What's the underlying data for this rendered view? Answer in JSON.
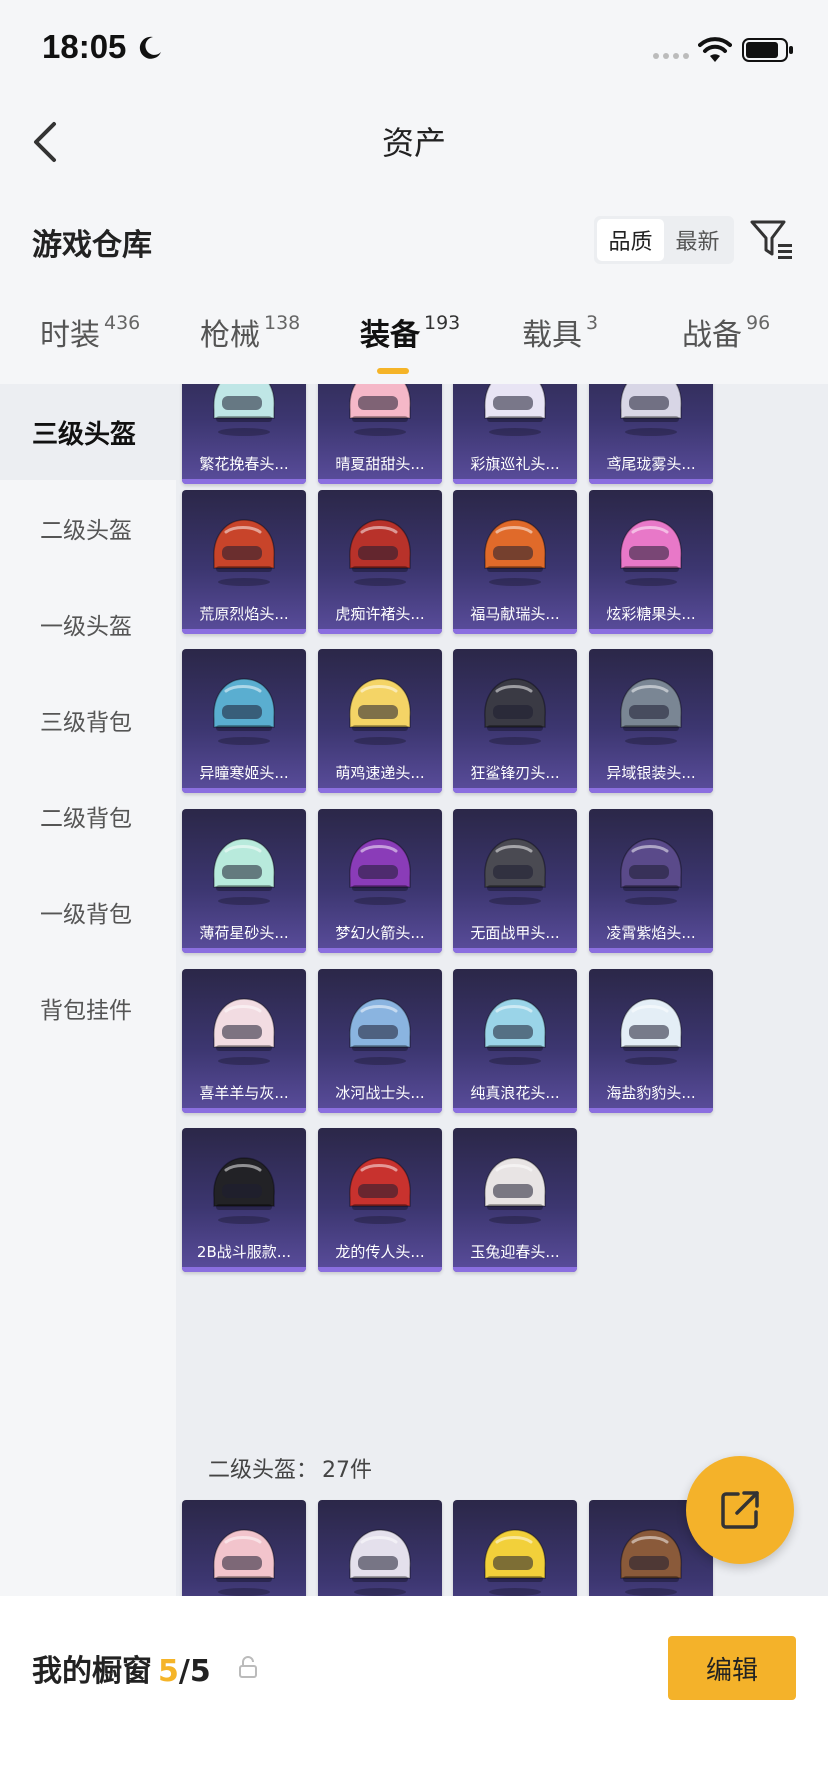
{
  "status_bar": {
    "time": "18:05"
  },
  "nav": {
    "title": "资产"
  },
  "warehouse": {
    "title": "游戏仓库",
    "sort_options": [
      "品质",
      "最新"
    ],
    "sort_selected": "品质"
  },
  "tabs": [
    {
      "label": "时装",
      "count": "436"
    },
    {
      "label": "枪械",
      "count": "138"
    },
    {
      "label": "装备",
      "count": "193",
      "active": true
    },
    {
      "label": "载具",
      "count": "3"
    },
    {
      "label": "战备",
      "count": "96"
    }
  ],
  "sidebar": {
    "items": [
      "三级头盔",
      "二级头盔",
      "一级头盔",
      "三级背包",
      "二级背包",
      "一级背包",
      "背包挂件"
    ],
    "active": "三级头盔"
  },
  "items": [
    {
      "name": "繁花挽春头...",
      "color": "#bfe6e6"
    },
    {
      "name": "晴夏甜甜头...",
      "color": "#f5b8c8"
    },
    {
      "name": "彩旗巡礼头...",
      "color": "#e8e4f4"
    },
    {
      "name": "鸢尾珑雾头...",
      "color": "#d8d6e6"
    },
    {
      "name": "荒原烈焰头...",
      "color": "#c8442a"
    },
    {
      "name": "虎痴许褚头...",
      "color": "#b8322a"
    },
    {
      "name": "福马献瑞头...",
      "color": "#e06a2a"
    },
    {
      "name": "炫彩糖果头...",
      "color": "#e878c8"
    },
    {
      "name": "异瞳寒姬头...",
      "color": "#5aaed0"
    },
    {
      "name": "萌鸡速递头...",
      "color": "#f4d466"
    },
    {
      "name": "狂鲨锋刃头...",
      "color": "#3a3a44"
    },
    {
      "name": "异域银装头...",
      "color": "#7a8694"
    },
    {
      "name": "薄荷星砂头...",
      "color": "#b8eadc"
    },
    {
      "name": "梦幻火箭头...",
      "color": "#8a3cb8"
    },
    {
      "name": "无面战甲头...",
      "color": "#4a4a52"
    },
    {
      "name": "凌霄紫焰头...",
      "color": "#5a4a8a"
    },
    {
      "name": "喜羊羊与灰...",
      "color": "#f2dce2"
    },
    {
      "name": "冰河战士头...",
      "color": "#8ab4e0"
    },
    {
      "name": "纯真浪花头...",
      "color": "#9ad4e8"
    },
    {
      "name": "海盐豹豹头...",
      "color": "#e4eef6"
    },
    {
      "name": "2B战斗服款...",
      "color": "#222226"
    },
    {
      "name": "龙的传人头...",
      "color": "#c8322e"
    },
    {
      "name": "玉兔迎春头...",
      "color": "#e8e4e4"
    }
  ],
  "next_section": {
    "label": "二级头盔：",
    "count": "27件"
  },
  "next_items": [
    {
      "color": "#f2c4cc"
    },
    {
      "color": "#e4e0ec"
    },
    {
      "color": "#f2d03a"
    },
    {
      "color": "#8a5a3a"
    }
  ],
  "bottom": {
    "showcase_label": "我的橱窗",
    "showcase_count": "5",
    "showcase_total": "/5",
    "edit_label": "编辑"
  },
  "colors": {
    "accent": "#f4b22a",
    "card_bg": "#3c3670"
  }
}
